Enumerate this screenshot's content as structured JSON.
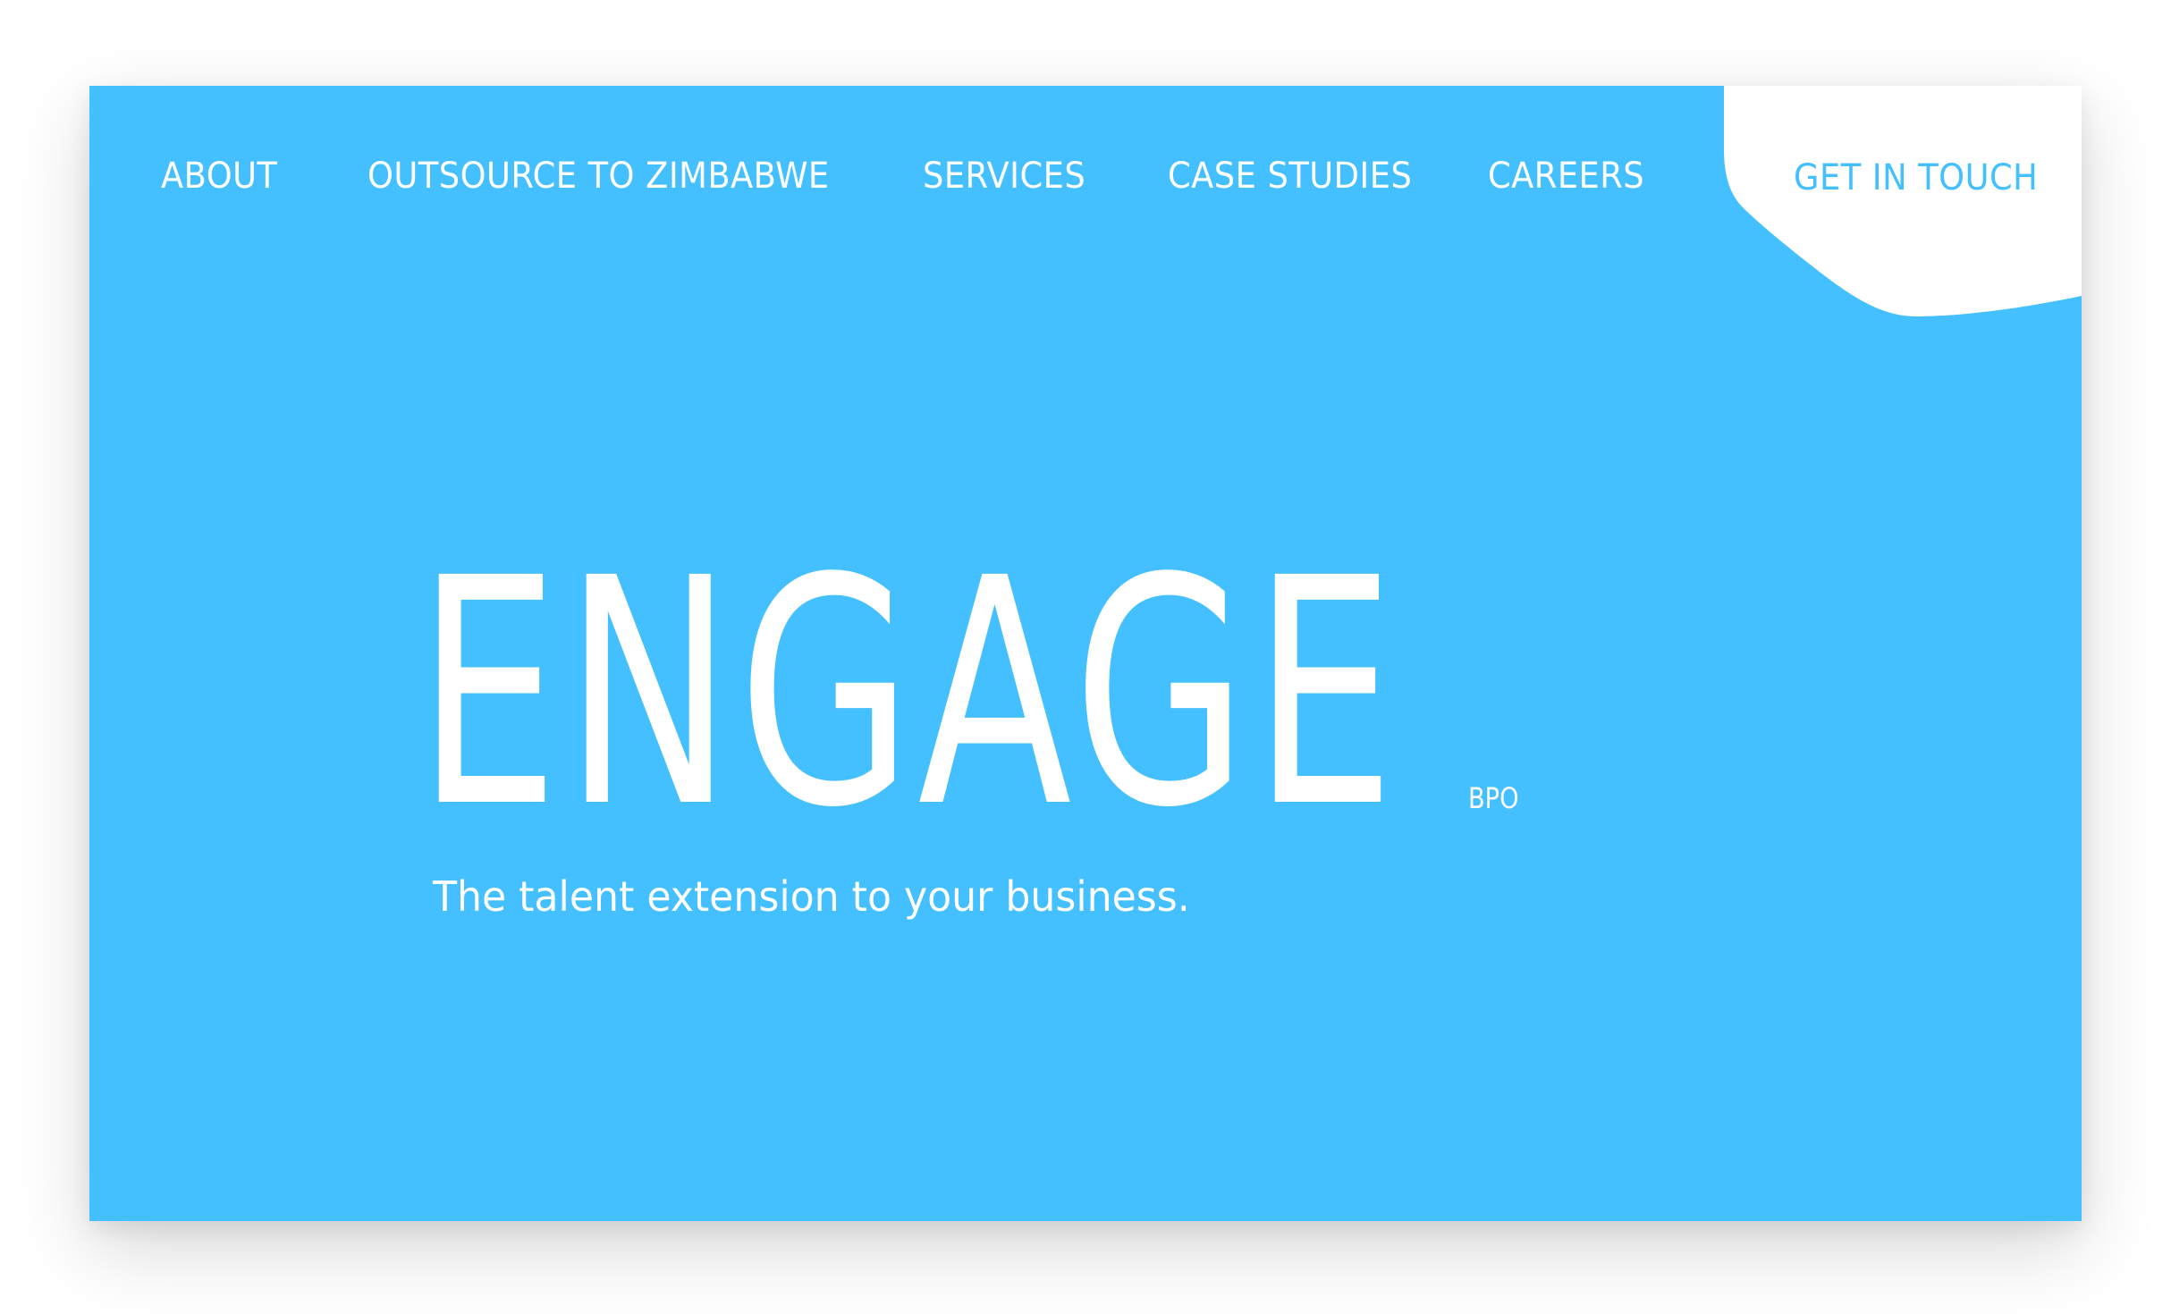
{
  "colors": {
    "hero_background": "#44bfff",
    "text_primary": "#ffffff",
    "cta_text": "#44bfff",
    "cta_background": "#ffffff"
  },
  "nav": {
    "items": [
      {
        "label": "ABOUT"
      },
      {
        "label": "OUTSOURCE TO ZIMBABWE"
      },
      {
        "label": "SERVICES"
      },
      {
        "label": "CASE STUDIES"
      },
      {
        "label": "CAREERS"
      }
    ],
    "cta_label": "GET IN TOUCH"
  },
  "hero": {
    "logo_text": "ENGAGE",
    "logo_suffix": "BPO",
    "tagline": "The talent extension to your business."
  }
}
